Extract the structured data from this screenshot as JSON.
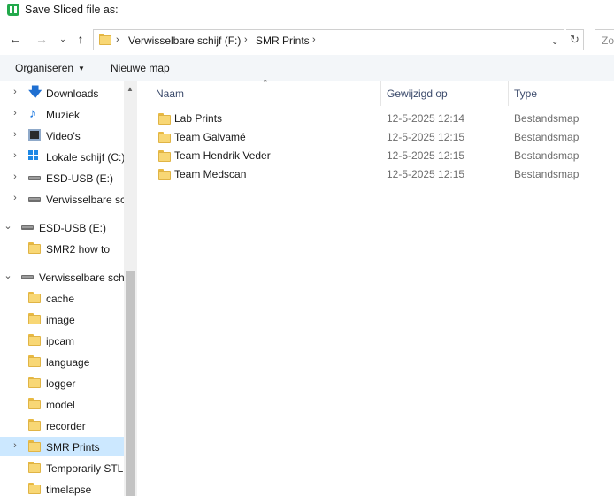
{
  "window": {
    "title": "Save Sliced file as:"
  },
  "address": {
    "crumbs": [
      "Verwisselbare schijf (F:)",
      "SMR Prints"
    ],
    "separator": "›",
    "search_placeholder": "Zo"
  },
  "toolbar": {
    "organize_label": "Organiseren",
    "new_folder_label": "Nieuwe map"
  },
  "navpane": {
    "items": [
      {
        "label": "Downloads",
        "icon": "download-icon"
      },
      {
        "label": "Muziek",
        "icon": "music-icon"
      },
      {
        "label": "Video's",
        "icon": "video-icon"
      },
      {
        "label": "Lokale schijf (C:)",
        "icon": "windows-drive-icon"
      },
      {
        "label": "ESD-USB (E:)",
        "icon": "drive-icon"
      },
      {
        "label": "Verwisselbare schijf (F:)",
        "icon": "drive-icon"
      },
      {
        "label": "ESD-USB (E:)",
        "icon": "drive-icon"
      },
      {
        "label": "SMR2 how to",
        "icon": "folder-icon"
      },
      {
        "label": "Verwisselbare schijf (F:)",
        "icon": "drive-icon"
      },
      {
        "label": "cache",
        "icon": "folder-icon"
      },
      {
        "label": "image",
        "icon": "folder-icon"
      },
      {
        "label": "ipcam",
        "icon": "folder-icon"
      },
      {
        "label": "language",
        "icon": "folder-icon"
      },
      {
        "label": "logger",
        "icon": "folder-icon"
      },
      {
        "label": "model",
        "icon": "folder-icon"
      },
      {
        "label": "recorder",
        "icon": "folder-icon"
      },
      {
        "label": "SMR Prints",
        "icon": "folder-icon",
        "selected": true
      },
      {
        "label": "Temporarily STL",
        "icon": "folder-icon"
      },
      {
        "label": "timelapse",
        "icon": "folder-icon"
      }
    ]
  },
  "files": {
    "columns": {
      "name": "Naam",
      "modified": "Gewijzigd op",
      "type": "Type"
    },
    "rows": [
      {
        "name": "Lab Prints",
        "modified": "12-5-2025 12:14",
        "type": "Bestandsmap"
      },
      {
        "name": "Team Galvamé",
        "modified": "12-5-2025 12:15",
        "type": "Bestandsmap"
      },
      {
        "name": "Team Hendrik Veder",
        "modified": "12-5-2025 12:15",
        "type": "Bestandsmap"
      },
      {
        "name": "Team Medscan",
        "modified": "12-5-2025 12:15",
        "type": "Bestandsmap"
      }
    ]
  },
  "colors": {
    "accent_app": "#22a94b",
    "selection": "#cce8ff",
    "folder": "#f8d775"
  }
}
